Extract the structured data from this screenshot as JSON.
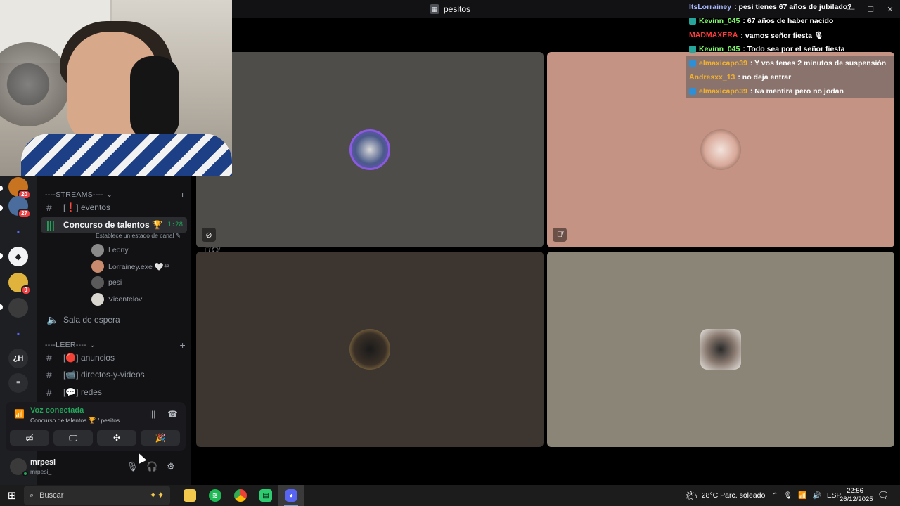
{
  "window": {
    "title": "pesitos",
    "controls": [
      "—",
      "☐",
      "✕"
    ]
  },
  "rail": {
    "servers": [
      {
        "name": "server-1",
        "badge": "20",
        "color": "#c8731f",
        "glyph": ""
      },
      {
        "name": "server-2",
        "badge": "27",
        "color": "#4a6d9e",
        "glyph": ""
      },
      {
        "name": "folder-1",
        "badge": "",
        "color": "#5865f2",
        "glyph": "▪"
      },
      {
        "name": "server-3",
        "badge": "",
        "color": "#f2f3f5",
        "glyph": "◆"
      },
      {
        "name": "server-4",
        "badge": "9",
        "color": "#e0b43c",
        "glyph": ""
      },
      {
        "name": "server-5",
        "badge": "",
        "color": "#3b3b3b",
        "glyph": ""
      },
      {
        "name": "folder-2",
        "badge": "",
        "color": "#5865f2",
        "glyph": "▪"
      },
      {
        "name": "server-h",
        "badge": "",
        "color": "#2b2d31",
        "glyph": "¿H"
      },
      {
        "name": "server-last",
        "badge": "",
        "color": "#2b2d31",
        "glyph": "≡"
      }
    ]
  },
  "channels": {
    "cat_streams": "----STREAMS----",
    "cat_streams_chevron": "⌄",
    "eventos": "[❗] eventos",
    "active_channel": "Concurso de talentos 🏆",
    "active_timer": "1:28",
    "active_status": "Establece un estado de canal ✎",
    "voice_users": [
      {
        "name": "Leony",
        "icons": "🎙̸ 🎧̸",
        "color": "#8a8a8a"
      },
      {
        "name": "Lorrainey.exe 🤍⁴³",
        "icons": "🎙̸",
        "color": "#c98a6d"
      },
      {
        "name": "pesi",
        "icons": "",
        "color": "#5a5a5a"
      },
      {
        "name": "Vicentelov",
        "icons": "",
        "color": "#d9d5cf"
      }
    ],
    "sala": "Sala de espera",
    "cat_leer": "----LEER----",
    "anuncios": "[🔴] anuncios",
    "directos": "[📹] directos-y-videos",
    "redes": "[💬] redes",
    "plus": "+"
  },
  "voice": {
    "title": "Voz conectada",
    "subtitle": "Concurso de talentos 🏆 / pesitos"
  },
  "user": {
    "name": "mrpesi",
    "tag": "mrpesi_"
  },
  "chat": [
    {
      "user": "ItsLorrainey",
      "color": "#a8b8ff",
      "text": ": pesi tienes 67 años de jubilado?",
      "badge": false,
      "hl": false
    },
    {
      "user": "Kevinn_045",
      "color": "#7dff6a",
      "text": ": 67 años de haber nacido",
      "badge": true,
      "hl": false
    },
    {
      "user": "MADMAXERA",
      "color": "#ff3b3b",
      "text": ": vamos señor fiesta 🎙",
      "badge": false,
      "hl": false
    },
    {
      "user": "Kevinn_045",
      "color": "#7dff6a",
      "text": ": Todo sea por el señor fiesta",
      "badge": true,
      "hl": false
    },
    {
      "user": "elmaxicapo39",
      "color": "#f2b12f",
      "text": ": Y vos tenes 2 minutos de suspensión",
      "badge": true,
      "hl": true
    },
    {
      "user": "Andresxx_13",
      "color": "#f2b12f",
      "text": ": no deja entrar",
      "badge": false,
      "hl": true
    },
    {
      "user": "elmaxicapo39",
      "color": "#f2b12f",
      "text": ": Na mentira pero no jodan",
      "badge": true,
      "hl": true
    }
  ],
  "taskbar": {
    "search": "Buscar",
    "weather": "28°C  Parc. soleado",
    "lang": "ESP",
    "time": "22:56",
    "date": "26/12/2025"
  }
}
